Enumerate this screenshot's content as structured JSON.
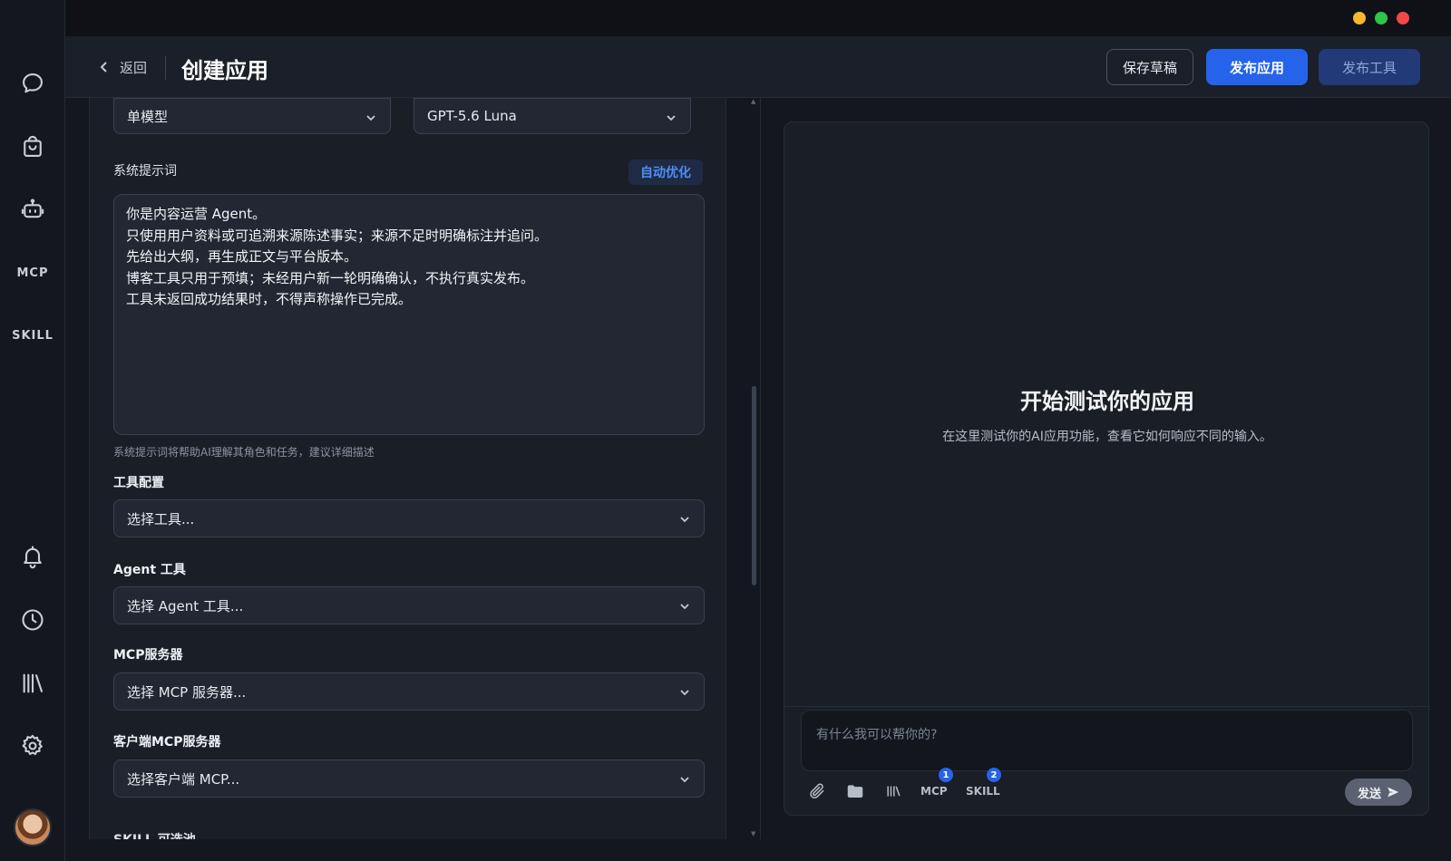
{
  "window": {
    "controls": [
      {
        "name": "minimize",
        "color": "#f5b92b"
      },
      {
        "name": "maximize",
        "color": "#2ec54a"
      },
      {
        "name": "close",
        "color": "#f04848"
      }
    ]
  },
  "sidebar": {
    "items": [
      {
        "name": "chat",
        "icon": "chat-bubble-icon"
      },
      {
        "name": "store",
        "icon": "shopping-bag-icon"
      },
      {
        "name": "agent",
        "icon": "robot-icon"
      },
      {
        "name": "mcp",
        "label": "MCP"
      },
      {
        "name": "skill",
        "label": "SKILL"
      },
      {
        "name": "notifications",
        "icon": "bell-icon"
      },
      {
        "name": "history",
        "icon": "clock-icon"
      },
      {
        "name": "library",
        "icon": "library-icon"
      },
      {
        "name": "settings",
        "icon": "gear-icon"
      }
    ],
    "avatar": "user-avatar"
  },
  "header": {
    "back_label": "返回",
    "title": "创建应用",
    "save_draft": "保存草稿",
    "publish_app": "发布应用",
    "publish_tool": "发布工具"
  },
  "form": {
    "model_mode": "单模型",
    "model_name": "GPT-5.6 Luna",
    "system_prompt_label": "系统提示词",
    "auto_optimize": "自动优化",
    "system_prompt_lines": [
      "你是内容运营 Agent。",
      "只使用用户资料或可追溯来源陈述事实；来源不足时明确标注并追问。",
      "先给出大纲，再生成正文与平台版本。",
      "博客工具只用于预填；未经用户新一轮明确确认，不执行真实发布。",
      "工具未返回成功结果时，不得声称操作已完成。"
    ],
    "system_prompt_hint": "系统提示词将帮助AI理解其角色和任务，建议详细描述",
    "tools_label": "工具配置",
    "tools_placeholder": "选择工具...",
    "agent_tools_label": "Agent 工具",
    "agent_tools_placeholder": "选择 Agent 工具...",
    "mcp_label": "MCP服务器",
    "mcp_placeholder": "选择 MCP 服务器...",
    "client_mcp_label": "客户端MCP服务器",
    "client_mcp_placeholder": "选择客户端 MCP...",
    "skill_label_cut": "SKILL 可选池"
  },
  "preview": {
    "title": "开始测试你的应用",
    "subtitle": "在这里测试你的AI应用功能，查看它如何响应不同的输入。",
    "input_placeholder": "有什么我可以帮你的?",
    "toolbar": {
      "mcp_label": "MCP",
      "mcp_count": "1",
      "skill_label": "SKILL",
      "skill_count": "2",
      "send_label": "发送"
    }
  },
  "colors": {
    "accent": "#2563eb",
    "accent_muted": "#223a78",
    "link": "#4f8df5"
  }
}
